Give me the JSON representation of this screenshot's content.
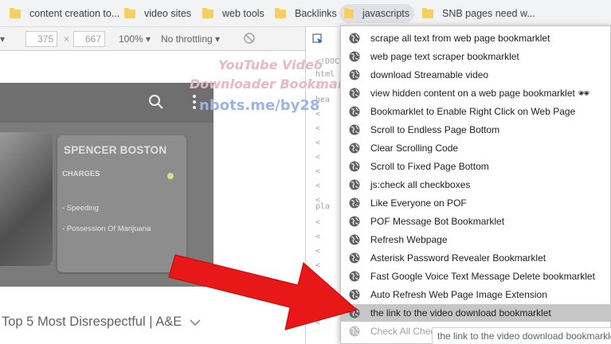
{
  "bookmarks_bar": [
    {
      "label": "content creation to...",
      "active": false
    },
    {
      "label": "video sites",
      "active": false
    },
    {
      "label": "web tools",
      "active": false
    },
    {
      "label": "Backlinks",
      "active": false
    },
    {
      "label": "javascripts",
      "active": true
    },
    {
      "label": "SNB  pages need w...",
      "active": false
    }
  ],
  "devtools_toolbar": {
    "width_value": "375",
    "height_value": "667",
    "zoom": "100%",
    "throttling": "No throttling"
  },
  "page": {
    "card_name": "SPENCER BOSTON",
    "charges_heading": "CHARGES",
    "charges": [
      "- Speeding",
      "- Possession Of Marijuana"
    ],
    "article_title": "Top 5 Most Disrespectful | A&E"
  },
  "overlay": {
    "line1": "YouTube Video",
    "line2": "Downloader Bookmarklet",
    "line3": "nbots.me/by28"
  },
  "elements_code": [
    "<!DOC",
    "html",
    "<",
    "hea",
    "< ",
    "<",
    "<",
    "<",
    "<",
    "<",
    "<",
    "pla",
    "<",
    "<",
    "<",
    "<",
    "<",
    "<",
    "<",
    "<"
  ],
  "menu_items": [
    {
      "label": "scrape all text from web page bookmarklet"
    },
    {
      "label": "web page text scraper bookmarklet"
    },
    {
      "label": "download Streamable video"
    },
    {
      "label": "view hidden content on a web page bookmarklet 🕶"
    },
    {
      "label": "Bookmarklet to Enable Right Click on Web Page"
    },
    {
      "label": "Scroll to Endless Page Bottom"
    },
    {
      "label": "Clear Scrolling Code"
    },
    {
      "label": "Scroll to Fixed Page Bottom"
    },
    {
      "label": "js:check all checkboxes"
    },
    {
      "label": "Like Everyone on POF"
    },
    {
      "label": "POF Message Bot Bookmarklet"
    },
    {
      "label": "Refresh Webpage"
    },
    {
      "label": "Asterisk Password Revealer Bookmarklet"
    },
    {
      "label": "Fast Google Voice Text Message Delete bookmarklet"
    },
    {
      "label": "Auto Refresh Web Page Image Extension"
    },
    {
      "label": "the link to the video download bookmarklet",
      "highlighted": true
    },
    {
      "label": "Check All Chec",
      "faded": true
    }
  ],
  "tooltip": "the link to the video download bookmarklet",
  "colors": {
    "arrow": "#ee1111",
    "highlight": "#c6c6c6",
    "folder": "#f5cf64"
  },
  "icons": {
    "menu_item": "globe-icon",
    "bookmark": "folder-icon",
    "search": "search-icon",
    "menu": "more-vert-icon"
  }
}
